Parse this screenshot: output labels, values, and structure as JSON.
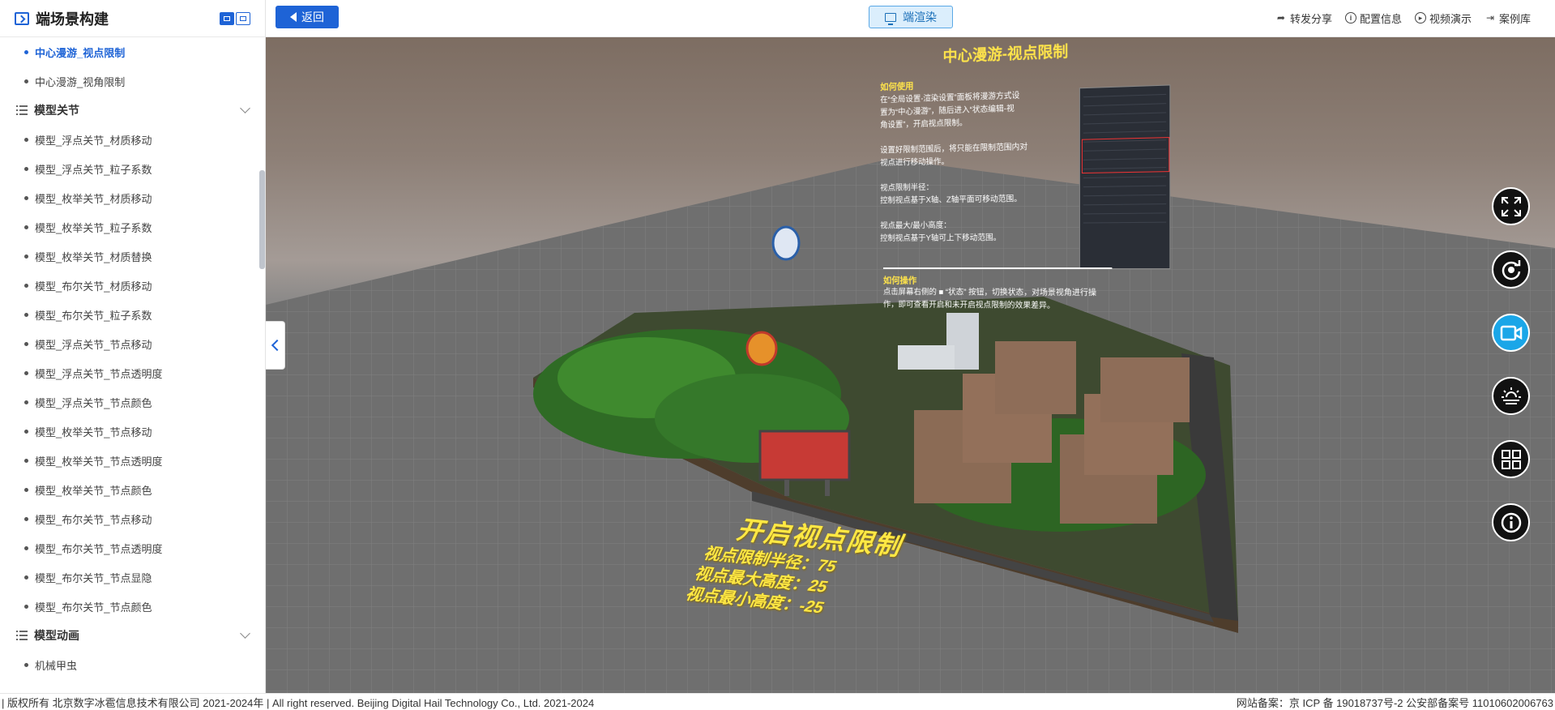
{
  "sidebar": {
    "title": "端场景构建",
    "items_top": [
      {
        "label": "中心漫游_视点限制",
        "active": true
      },
      {
        "label": "中心漫游_视角限制",
        "active": false
      }
    ],
    "group1": {
      "label": "模型关节",
      "items": [
        "模型_浮点关节_材质移动",
        "模型_浮点关节_粒子系数",
        "模型_枚举关节_材质移动",
        "模型_枚举关节_粒子系数",
        "模型_枚举关节_材质替换",
        "模型_布尔关节_材质移动",
        "模型_布尔关节_粒子系数",
        "模型_浮点关节_节点移动",
        "模型_浮点关节_节点透明度",
        "模型_浮点关节_节点颜色",
        "模型_枚举关节_节点移动",
        "模型_枚举关节_节点透明度",
        "模型_枚举关节_节点颜色",
        "模型_布尔关节_节点移动",
        "模型_布尔关节_节点透明度",
        "模型_布尔关节_节点显隐",
        "模型_布尔关节_节点颜色"
      ]
    },
    "group2": {
      "label": "模型动画",
      "items": [
        "机械甲虫"
      ]
    }
  },
  "topbar": {
    "back_label": "返回",
    "render_label": "端渲染",
    "links": [
      {
        "icon": "share-icon",
        "label": "转发分享"
      },
      {
        "icon": "info-icon",
        "label": "配置信息"
      },
      {
        "icon": "play-icon",
        "label": "视频演示"
      },
      {
        "icon": "exit-icon",
        "label": "案例库"
      }
    ]
  },
  "scene": {
    "panel_title": "中心漫游-视点限制",
    "how_to_use_title": "如何使用",
    "how_to_use_text": "在“全局设置-渲染设置”面板将漫游方式设\n置为“中心漫游”，随后进入“状态编辑-视\n角设置”，开启视点限制。\n\n设置好限制范围后，将只能在限制范围内对\n视点进行移动操作。\n\n视点限制半径：\n    控制视点基于X轴、Z轴平面可移动范围。\n\n视点最大/最小高度：\n    控制视点基于Y轴可上下移动范围。",
    "how_to_operate_title": "如何操作",
    "how_to_operate_text": "点击屏幕右侧的 ■ “状态” 按钮，切换状态，对场景视角进行操\n作，即可查看开启和未开启视点限制的效果差异。",
    "label_heading": "开启视点限制",
    "label_lines": [
      "视点限制半径：75",
      "视点最大高度：25",
      "视点最小高度：-25"
    ]
  },
  "tools": [
    {
      "name": "fullscreen-icon",
      "active": false
    },
    {
      "name": "reset-view-icon",
      "active": false
    },
    {
      "name": "camera-icon",
      "active": true
    },
    {
      "name": "weather-icon",
      "active": false
    },
    {
      "name": "grid-icon",
      "active": false
    },
    {
      "name": "info-icon",
      "active": false
    }
  ],
  "footer": {
    "left": "| 版权所有 北京数字冰雹信息技术有限公司 2021-2024年 | All right reserved. Beijing Digital Hail Technology Co., Ltd. 2021-2024",
    "right": "网站备案：京 ICP 备 19018737号-2 公安部备案号 11010602006763"
  },
  "colors": {
    "accent": "#1e63d6",
    "yellow_text": "#ffe44a",
    "active_tool": "#1aa6e8"
  }
}
